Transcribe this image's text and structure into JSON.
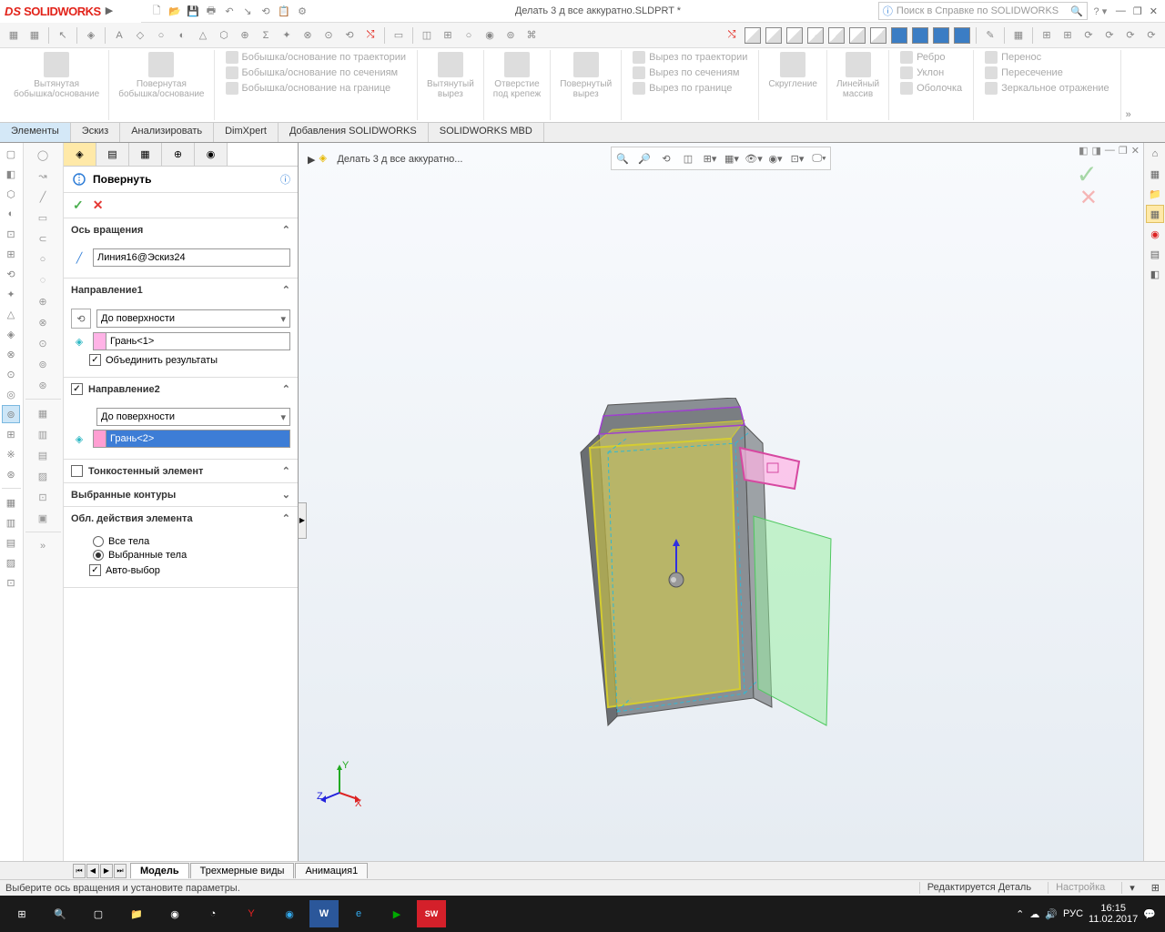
{
  "title": "Делать 3 д все аккуратно.SLDPRT *",
  "search_placeholder": "Поиск в Справке по SOLIDWORKS",
  "ribbon": {
    "extrude_boss": "Вытянутая\nбобышка/основание",
    "revolve_boss": "Повернутая\nбобышка/основание",
    "swept": "Бобышка/основание по траектории",
    "loft": "Бобышка/основание по сечениям",
    "boundary": "Бобышка/основание на границе",
    "extrude_cut": "Вытянутый\nвырез",
    "hole": "Отверстие\nпод крепеж",
    "revolve_cut": "Повернутый\nвырез",
    "swept_cut": "Вырез по траектории",
    "loft_cut": "Вырез по сечениям",
    "boundary_cut": "Вырез по границе",
    "fillet": "Скругление",
    "pattern": "Линейный\nмассив",
    "rib": "Ребро",
    "draft": "Уклон",
    "shell": "Оболочка",
    "wrap": "Перенос",
    "intersect": "Пересечение",
    "mirror": "Зеркальное отражение"
  },
  "tabs": [
    "Элементы",
    "Эскиз",
    "Анализировать",
    "DimXpert",
    "Добавления SOLIDWORKS",
    "SOLIDWORKS MBD"
  ],
  "breadcrumb": "Делать 3 д все аккуратно...",
  "pm": {
    "title": "Повернуть",
    "axis_hdr": "Ось вращения",
    "axis_val": "Линия16@Эскиз24",
    "dir1_hdr": "Направление1",
    "end_cond": "До поверхности",
    "face1": "Грань<1>",
    "merge": "Объединить результаты",
    "dir2_hdr": "Направление2",
    "face2": "Грань<2>",
    "thin": "Тонкостенный элемент",
    "contours": "Выбранные контуры",
    "scope_hdr": "Обл. действия элемента",
    "all_bodies": "Все тела",
    "sel_bodies": "Выбранные тела",
    "auto_sel": "Авто-выбор"
  },
  "bottom_tabs": [
    "Модель",
    "Трехмерные виды",
    "Анимация1"
  ],
  "statusbar": {
    "hint": "Выберите ось вращения и установите параметры.",
    "editing": "Редактируется Деталь",
    "custom": "Настройка"
  },
  "tray": {
    "lang": "РУС",
    "time": "16:15",
    "date": "11.02.2017"
  }
}
